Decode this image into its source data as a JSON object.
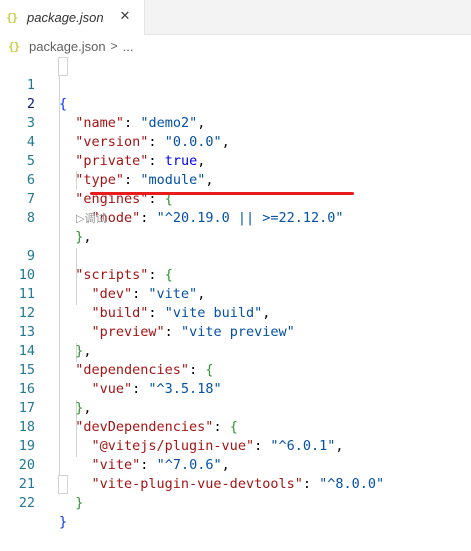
{
  "tab": {
    "icon": "{}",
    "label": "package.json",
    "close": "✕"
  },
  "breadcrumb": {
    "icon": "{}",
    "file": "package.json",
    "separator": ">",
    "more": "..."
  },
  "codelens": {
    "label": "▷调试"
  },
  "lines": [
    {
      "n": "1"
    },
    {
      "n": "2"
    },
    {
      "n": "3"
    },
    {
      "n": "4"
    },
    {
      "n": "5"
    },
    {
      "n": "6"
    },
    {
      "n": "7"
    },
    {
      "n": "8"
    },
    {
      "n": "9"
    },
    {
      "n": "10"
    },
    {
      "n": "11"
    },
    {
      "n": "12"
    },
    {
      "n": "13"
    },
    {
      "n": "14"
    },
    {
      "n": "15"
    },
    {
      "n": "16"
    },
    {
      "n": "17"
    },
    {
      "n": "18"
    },
    {
      "n": "19"
    },
    {
      "n": "20"
    },
    {
      "n": "21"
    },
    {
      "n": "22"
    }
  ],
  "code": {
    "open_brace": "{",
    "name_key": "\"name\"",
    "name_val": "\"demo2\"",
    "version_key": "\"version\"",
    "version_val": "\"0.0.0\"",
    "private_key": "\"private\"",
    "private_val": "true",
    "type_key": "\"type\"",
    "type_val": "\"module\"",
    "engines_key": "\"engines\"",
    "node_key": "\"node\"",
    "node_val": "\"^20.19.0 || >=22.12.0\"",
    "scripts_key": "\"scripts\"",
    "dev_key": "\"dev\"",
    "dev_val": "\"vite\"",
    "build_key": "\"build\"",
    "build_val": "\"vite build\"",
    "preview_key": "\"preview\"",
    "preview_val": "\"vite preview\"",
    "dependencies_key": "\"dependencies\"",
    "vue_key": "\"vue\"",
    "vue_val": "\"^3.5.18\"",
    "devdeps_key": "\"devDependencies\"",
    "pluginvue_key": "\"@vitejs/plugin-vue\"",
    "pluginvue_val": "\"^6.0.1\"",
    "vite_key": "\"vite\"",
    "vite_val": "\"^7.0.6\"",
    "devtools_key": "\"vite-plugin-vue-devtools\"",
    "devtools_val": "\"^8.0.0\"",
    "close_brace": "}"
  },
  "colors": {
    "key": "#a31515",
    "string": "#0451a5",
    "boolean": "#0000ff",
    "line_number": "#237893",
    "annotation": "#e81c1c"
  }
}
